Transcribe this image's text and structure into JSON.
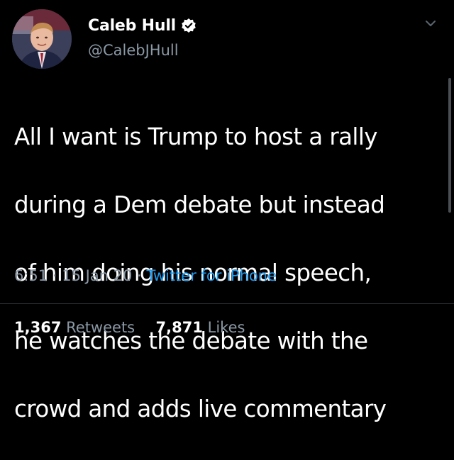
{
  "author": {
    "display_name": "Caleb Hull",
    "handle": "@CalebJHull",
    "verified": true,
    "avatar_icon": "profile-photo"
  },
  "tweet": {
    "text_lines": [
      "All I want is Trump to host a rally",
      "during a Dem debate but instead",
      "of him doing his normal speech,",
      "he watches the debate with the",
      "crowd and adds live commentary"
    ],
    "time": "6:51",
    "date": "15 Jan 20",
    "separator": "·",
    "source": "Twitter for iPhone"
  },
  "stats": {
    "retweets_count": "1,367",
    "retweets_label": "Retweets",
    "likes_count": "7,871",
    "likes_label": "Likes"
  },
  "colors": {
    "background": "#000000",
    "text": "#ffffff",
    "secondary": "#8b98a5",
    "link": "#1d9bf0",
    "verified_badge": "#ffffff"
  },
  "icons": {
    "verified": "verified-badge-icon",
    "menu": "chevron-down-icon"
  }
}
